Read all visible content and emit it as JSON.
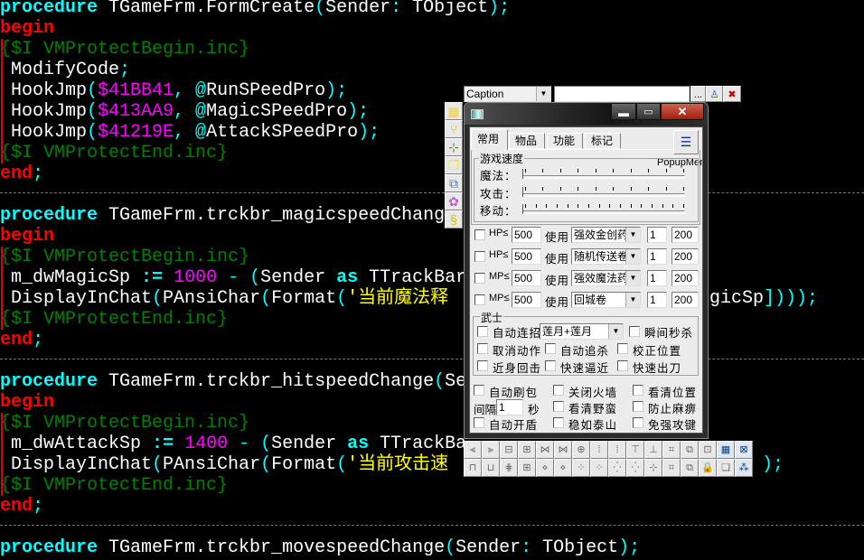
{
  "code": {
    "lines": [
      {
        "tokens": [
          [
            "kw",
            "procedure"
          ],
          [
            "id",
            " TGameFrm.FormCreate"
          ],
          [
            "pn",
            "("
          ],
          [
            "id",
            "Sender"
          ],
          [
            "pn",
            ":"
          ],
          [
            "id",
            " TObject"
          ],
          [
            "pn",
            ");"
          ]
        ]
      },
      {
        "tokens": [
          [
            "kr",
            "begin"
          ]
        ]
      },
      {
        "tokens": [
          [
            "cm",
            "{$I VMProtectBegin.inc}"
          ]
        ]
      },
      {
        "tokens": [
          [
            "id",
            " ModifyCode"
          ],
          [
            "pn",
            ";"
          ]
        ]
      },
      {
        "tokens": [
          [
            "id",
            " HookJmp"
          ],
          [
            "pn",
            "("
          ],
          [
            "num",
            "$41BB41"
          ],
          [
            "pn",
            ", @"
          ],
          [
            "id",
            "RunSPeedPro"
          ],
          [
            "pn",
            ");"
          ]
        ]
      },
      {
        "tokens": [
          [
            "id",
            " HookJmp"
          ],
          [
            "pn",
            "("
          ],
          [
            "num",
            "$413AA9"
          ],
          [
            "pn",
            ", @"
          ],
          [
            "id",
            "MagicSPeedPro"
          ],
          [
            "pn",
            ");"
          ]
        ]
      },
      {
        "tokens": [
          [
            "id",
            " HookJmp"
          ],
          [
            "pn",
            "("
          ],
          [
            "num",
            "$41219E"
          ],
          [
            "pn",
            ", @"
          ],
          [
            "id",
            "AttackSPeedPro"
          ],
          [
            "pn",
            ");"
          ]
        ]
      },
      {
        "tokens": [
          [
            "cm",
            "{$I VMProtectEnd.inc}"
          ]
        ]
      },
      {
        "tokens": [
          [
            "kr",
            "end"
          ],
          [
            "pn",
            ";"
          ]
        ]
      },
      {
        "tokens": []
      },
      {
        "tokens": [
          [
            "kw",
            "procedure"
          ],
          [
            "id",
            " TGameFrm.trckbr_magicspeedChang"
          ]
        ]
      },
      {
        "tokens": [
          [
            "kr",
            "begin"
          ]
        ]
      },
      {
        "tokens": [
          [
            "cm",
            "{$I VMProtectBegin.inc}"
          ]
        ]
      },
      {
        "tokens": [
          [
            "id",
            " m_dwMagicSp "
          ],
          [
            "kw",
            ":="
          ],
          [
            "id",
            " "
          ],
          [
            "num",
            "1000"
          ],
          [
            "pn",
            " - ("
          ],
          [
            "id",
            "Sender "
          ],
          [
            "kw",
            "as"
          ],
          [
            "id",
            " TTrackBar"
          ]
        ]
      },
      {
        "tokens": [
          [
            "id",
            " DisplayInChat"
          ],
          [
            "pn",
            "("
          ],
          [
            "id",
            "PAnsiChar"
          ],
          [
            "pn",
            "("
          ],
          [
            "id",
            "Format"
          ],
          [
            "pn",
            "("
          ],
          [
            "str",
            "'当前魔法释"
          ]
        ],
        "tail": [
          [
            "id",
            "gicSp"
          ],
          [
            "pn",
            "])));"
          ]
        ]
      },
      {
        "tokens": [
          [
            "cm",
            "{$I VMProtectEnd.inc}"
          ]
        ]
      },
      {
        "tokens": [
          [
            "kr",
            "end"
          ],
          [
            "pn",
            ";"
          ]
        ]
      },
      {
        "tokens": []
      },
      {
        "tokens": [
          [
            "kw",
            "procedure"
          ],
          [
            "id",
            " TGameFrm.trckbr_hitspeedChange"
          ],
          [
            "pn",
            "("
          ],
          [
            "id",
            "Se"
          ]
        ]
      },
      {
        "tokens": [
          [
            "kr",
            "begin"
          ]
        ]
      },
      {
        "tokens": [
          [
            "cm",
            "{$I VMProtectBegin.inc}"
          ]
        ]
      },
      {
        "tokens": [
          [
            "id",
            " m_dwAttackSp "
          ],
          [
            "kw",
            ":="
          ],
          [
            "id",
            " "
          ],
          [
            "num",
            "1400"
          ],
          [
            "pn",
            " - ("
          ],
          [
            "id",
            "Sender "
          ],
          [
            "kw",
            "as"
          ],
          [
            "id",
            " TTrackBa"
          ]
        ]
      },
      {
        "tokens": [
          [
            "id",
            " DisplayInChat"
          ],
          [
            "pn",
            "("
          ],
          [
            "id",
            "PAnsiChar"
          ],
          [
            "pn",
            "("
          ],
          [
            "id",
            "Format"
          ],
          [
            "pn",
            "("
          ],
          [
            "str",
            "'当前攻击速"
          ]
        ],
        "tail": [
          [
            "pn",
            ");"
          ]
        ]
      },
      {
        "tokens": [
          [
            "cm",
            "{$I VMProtectEnd.inc}"
          ]
        ]
      },
      {
        "tokens": [
          [
            "kr",
            "end"
          ],
          [
            "pn",
            ";"
          ]
        ]
      },
      {
        "tokens": []
      },
      {
        "tokens": [
          [
            "kw",
            "procedure"
          ],
          [
            "id",
            " TGameFrm.trckbr_movespeedChange"
          ],
          [
            "pn",
            "("
          ],
          [
            "id",
            "Sender"
          ],
          [
            "pn",
            ":"
          ],
          [
            "id",
            " TObject"
          ],
          [
            "pn",
            ");"
          ]
        ]
      }
    ]
  },
  "inspector": {
    "combo_value": "Caption",
    "edit_value": "",
    "ellipsis": "..."
  },
  "left_toolbar_icons": [
    "select-grid-icon",
    "component-link-icon",
    "diagram-icon",
    "window-stack-icon",
    "form-tabs-icon",
    "data-module-icon",
    "script-icon"
  ],
  "form": {
    "tabs": [
      "常用",
      "物品",
      "功能",
      "标记"
    ],
    "active_tab": 0,
    "popup_label": "PopupMen",
    "speed_group": {
      "title": "游戏速度",
      "rows": [
        {
          "label": "魔法：",
          "value": 0
        },
        {
          "label": "攻击：",
          "value": 0
        },
        {
          "label": "移动：",
          "value": 0
        }
      ]
    },
    "use_label": "使用",
    "potion_rows": [
      {
        "label": "HP≤",
        "threshold": "500",
        "item": "强效金创药",
        "a": "1",
        "b": "200"
      },
      {
        "label": "HP≤",
        "threshold": "500",
        "item": "随机传送卷",
        "a": "1",
        "b": "200"
      },
      {
        "label": "MP≤",
        "threshold": "500",
        "item": "强效魔法药",
        "a": "1",
        "b": "200"
      },
      {
        "label": "MP≤",
        "threshold": "500",
        "item": "回城卷",
        "a": "1",
        "b": "200"
      }
    ],
    "warrior_group": {
      "title": "武士",
      "auto_combo": "自动连招",
      "combo_value": "莲月+莲月",
      "instant_kill": "瞬间秒杀",
      "checks": [
        [
          "取消动作",
          "自动追杀",
          "校正位置"
        ],
        [
          "近身回击",
          "快速逼近",
          "快速出刀"
        ]
      ]
    },
    "bottom": {
      "row1": [
        "自动刷包",
        "关闭火墙",
        "看清位置"
      ],
      "interval_label": "间隔",
      "interval_value": "1",
      "seconds_label": "秒",
      "row2": [
        "看清野蛮",
        "防止麻痹"
      ],
      "row3": [
        "自动开盾",
        "稳如泰山",
        "免强攻键"
      ]
    }
  },
  "align_palette_icons": [
    "align-left-icon",
    "align-right-icon",
    "align-center-h-icon",
    "center-in-window-h-icon",
    "space-equal-h-icon",
    "space-inc-h-icon",
    "align-center-v-icon",
    "space-equal-v-icon",
    "space-inc-v-icon",
    "align-top-icon",
    "align-bottom-icon",
    "center-in-window-icon",
    "bring-to-front-icon",
    "size-to-grid-icon",
    "grid-icon",
    "select-frame-icon",
    "align-width-icon",
    "align-height-icon",
    "align-middle-icon",
    "center-in-window-v-icon",
    "space-dec-h-icon",
    "space-remove-h-icon",
    "space-dec-v-icon",
    "space-remove-v-icon",
    "grow-icon",
    "shrink-icon",
    "size-icon",
    "scale-icon",
    "send-to-back-icon",
    "lock-controls-icon",
    "copy-icon",
    "tab-order-icon"
  ]
}
